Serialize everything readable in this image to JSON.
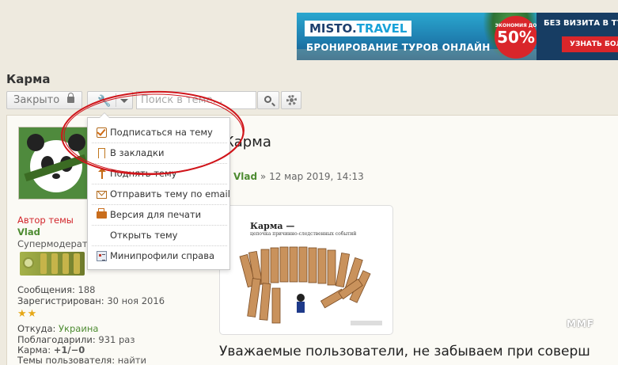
{
  "banner": {
    "logo_main": "MISTO.",
    "logo_accent": "TRAVEL",
    "tagline": "БРОНИРОВАНИЕ ТУРОВ ОНЛАЙН",
    "discount_label": "ЭКОНОМИЯ ДО",
    "discount_value": "50%",
    "visa_text": "БЕЗ ВИЗИТА В ТУРА",
    "order_button": "УЗНАТЬ БОЛЬШ"
  },
  "topic": {
    "title": "Карма"
  },
  "toolbar": {
    "locked_label": "Закрыто",
    "search_placeholder": "Поиск в теме…"
  },
  "menu": {
    "items": [
      {
        "label": "Подписаться на тему",
        "icon": "checkbox-icon"
      },
      {
        "label": "В закладки",
        "icon": "bookmark-icon"
      },
      {
        "label": "Поднять тему",
        "icon": "arrow-up-icon"
      },
      {
        "label": "Отправить тему по email",
        "icon": "mail-icon"
      },
      {
        "label": "Версия для печати",
        "icon": "printer-icon"
      },
      {
        "label": "Открыть тему",
        "icon": ""
      },
      {
        "label": "Минипрофили справа",
        "icon": "profile-card-icon"
      }
    ]
  },
  "author": {
    "role": "Автор темы",
    "name": "Vlad",
    "group": "Супермодератор"
  },
  "stats": {
    "posts_label": "Сообщения:",
    "posts_value": "188",
    "registered_label": "Зарегистрирован:",
    "registered_value": "30 ноя 2016",
    "stars": "★★",
    "from_label": "Откуда:",
    "from_value": "Украина",
    "thanked_label": "Поблагодарили:",
    "thanked_value": "931 раз",
    "karma_label": "Карма:",
    "karma_value": "+1/−0",
    "topics_label": "Темы пользователя:",
    "topics_value": "найти"
  },
  "post": {
    "heading": "Карма",
    "author": "Vlad",
    "meta_sep": " » ",
    "date": "12 мар 2019, 14:13",
    "image_title": "Карма —",
    "image_subtitle": "цепочка причинно-следственных событий",
    "body_text": "Уважаемые пользователи, не забываем при соверш"
  },
  "watermark": "MMF",
  "colors": {
    "annotation_red": "#d0141a",
    "username_green": "#4d8b31",
    "role_red": "#d2262c",
    "banner_blue": "#1f7fb0"
  }
}
